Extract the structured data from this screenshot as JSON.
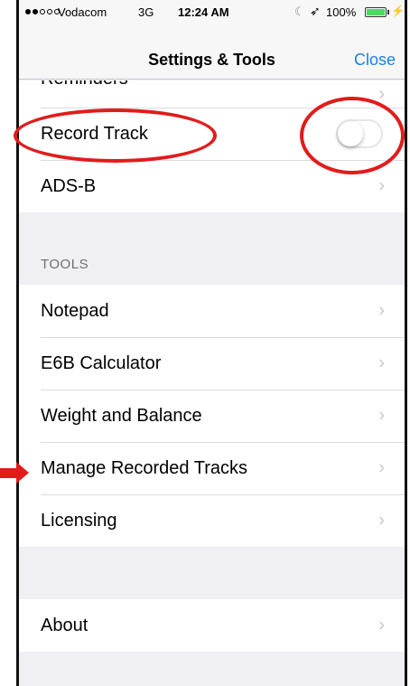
{
  "status_bar": {
    "carrier": "Vodacom",
    "network": "3G",
    "time": "12:24 AM",
    "battery": "100%",
    "signal_bars_filled": 2,
    "signal_bars_total": 5
  },
  "nav": {
    "title": "Settings & Tools",
    "close_label": "Close"
  },
  "settings": {
    "partial_item": "Reminders",
    "record_track_label": "Record Track",
    "record_track_enabled": false,
    "adsb_label": "ADS-B"
  },
  "tools": {
    "header": "TOOLS",
    "items": [
      {
        "label": "Notepad"
      },
      {
        "label": "E6B Calculator"
      },
      {
        "label": "Weight and Balance"
      },
      {
        "label": "Manage Recorded Tracks"
      },
      {
        "label": "Licensing"
      }
    ]
  },
  "about": {
    "label": "About"
  },
  "annotation_color": "#e21b1b",
  "accent_color": "#1a80e0"
}
